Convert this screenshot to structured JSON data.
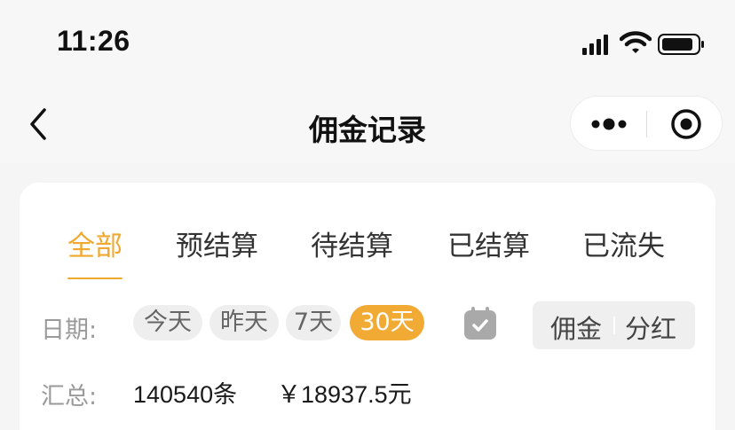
{
  "status_bar": {
    "time": "11:26",
    "icons": [
      "cellular-signal-icon",
      "wifi-icon",
      "battery-icon"
    ]
  },
  "nav": {
    "title": "佣金记录",
    "back_icon": "chevron-left-icon",
    "more_icon": "more-dots-icon",
    "close_icon": "target-close-icon"
  },
  "tabs": [
    {
      "label": "全部",
      "active": true
    },
    {
      "label": "预结算",
      "active": false
    },
    {
      "label": "待结算",
      "active": false
    },
    {
      "label": "已结算",
      "active": false
    },
    {
      "label": "已流失",
      "active": false
    }
  ],
  "date_filter": {
    "label": "日期:",
    "chips": [
      {
        "label": "今天",
        "active": false
      },
      {
        "label": "昨天",
        "active": false
      },
      {
        "label": "7天",
        "active": false
      },
      {
        "label": "30天",
        "active": true
      }
    ],
    "calendar_icon": "calendar-check-icon"
  },
  "type_toggle": {
    "options": [
      "佣金",
      "分红"
    ]
  },
  "summary": {
    "label": "汇总:",
    "count": "140540条",
    "amount": "￥18937.5元"
  },
  "colors": {
    "accent": "#f0a830",
    "chip_active_bg": "#f1ab35",
    "page_bg": "#f5f5f5",
    "card_bg": "#ffffff"
  }
}
